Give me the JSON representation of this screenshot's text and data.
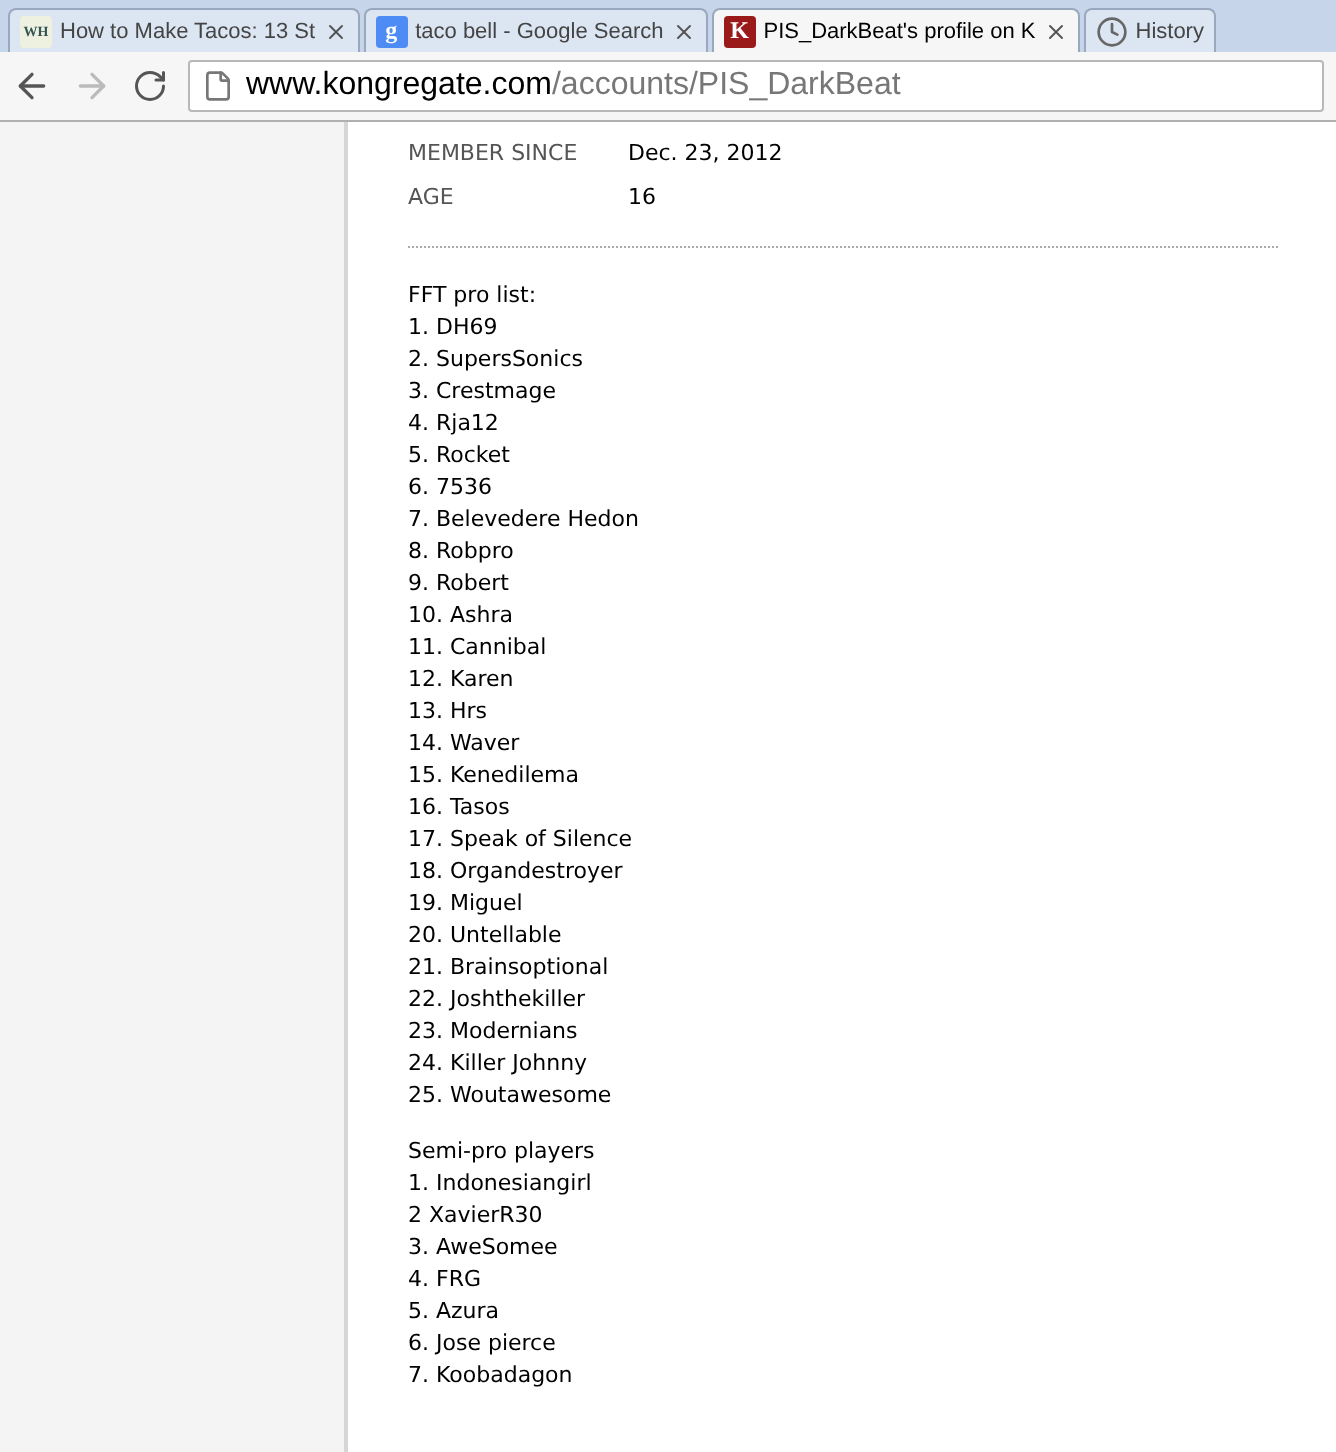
{
  "tabs": [
    {
      "title": "How to Make Tacos: 13 St",
      "kind": "letter",
      "favicon": "WH",
      "color": "#eef0e0",
      "selected": false
    },
    {
      "title": "taco bell - Google Search",
      "kind": "letter",
      "favicon": "g",
      "color": "#4d8cf5",
      "selected": false
    },
    {
      "title": "PIS_DarkBeat's profile on K",
      "kind": "letter",
      "favicon": "K",
      "color": "#9a1a1a",
      "selected": true
    },
    {
      "title": "History",
      "kind": "clock",
      "selected": false
    }
  ],
  "address": {
    "host": "www.kongregate.com",
    "path": "/accounts/PIS_DarkBeat"
  },
  "profile": [
    {
      "label": "MEMBER SINCE",
      "value": "Dec. 23, 2012"
    },
    {
      "label": "AGE",
      "value": "16"
    }
  ],
  "lists": [
    {
      "title": "FFT pro list:",
      "items": [
        "1. DH69",
        "2. SupersSonics",
        "3. Crestmage",
        "4. Rja12",
        "5. Rocket",
        "6. 7536",
        "7. Belevedere Hedon",
        "8. Robpro",
        "9. Robert",
        "10. Ashra",
        "11. Cannibal",
        "12. Karen",
        "13. Hrs",
        "14. Waver",
        "15. Kenedilema",
        "16. Tasos",
        "17. Speak of Silence",
        "18. Organdestroyer",
        "19. Miguel",
        "20. Untellable",
        "21. Brainsoptional",
        "22. Joshthekiller",
        "23. Modernians",
        "24. Killer Johnny",
        "25. Woutawesome"
      ]
    },
    {
      "title": "Semi-pro players",
      "items": [
        "1. Indonesiangirl",
        "2 XavierR30",
        "3. AweSomee",
        "4. FRG",
        "5. Azura",
        "6. Jose pierce",
        "7. Koobadagon"
      ]
    }
  ]
}
